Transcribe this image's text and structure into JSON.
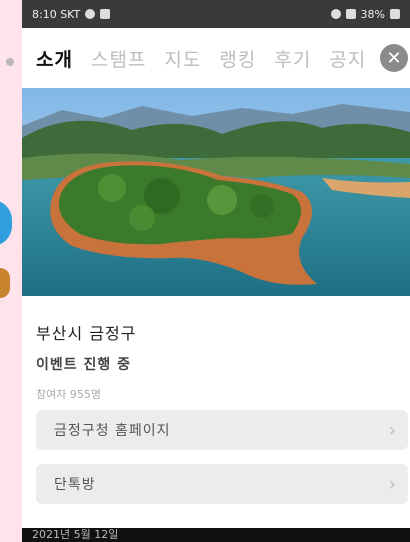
{
  "status_bar": {
    "time_carrier": "8:10 SKT",
    "battery": "38%"
  },
  "tabs": [
    {
      "label": "소개",
      "active": true
    },
    {
      "label": "스탬프",
      "active": false
    },
    {
      "label": "지도",
      "active": false
    },
    {
      "label": "랭킹",
      "active": false
    },
    {
      "label": "후기",
      "active": false
    },
    {
      "label": "공지",
      "active": false
    }
  ],
  "place": {
    "title": "부산시 금정구",
    "event_status": "이벤트 진행 중",
    "participants": "참여자 955명"
  },
  "links": [
    {
      "label": "금정구청 홈페이지"
    },
    {
      "label": "단톡방"
    }
  ],
  "footer": {
    "date_text": "2021년 5월 12일"
  },
  "colors": {
    "status_bar": "#3a3a3a",
    "active_tab": "#111111",
    "inactive_tab": "#bdbdbd",
    "row_bg": "#ececec",
    "left_strip": "#ffe3ea"
  },
  "icons": {
    "close": "close-icon",
    "chevron": "chevron-right-icon"
  }
}
